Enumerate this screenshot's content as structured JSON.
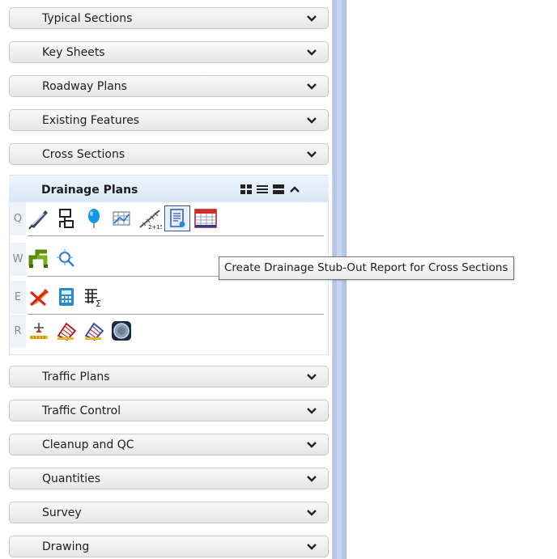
{
  "sections_top": [
    {
      "label": "Typical Sections"
    },
    {
      "label": "Key Sheets"
    },
    {
      "label": "Roadway Plans"
    },
    {
      "label": "Existing Features"
    },
    {
      "label": "Cross Sections"
    }
  ],
  "expanded": {
    "label": "Drainage Plans",
    "rows": [
      {
        "key": "Q",
        "tools": [
          "feather-pen-icon",
          "flowchart-icon",
          "blue-balloon-icon",
          "grid-chart-icon",
          "measure-line-icon",
          "report-document-icon",
          "spreadsheet-table-icon"
        ]
      },
      {
        "key": "W",
        "tools": [
          "pipe-network-icon",
          "search-sparkle-icon"
        ]
      },
      {
        "key": "E",
        "tools": [
          "pencil-eraser-icon",
          "calculator-icon",
          "table-sum-icon"
        ]
      },
      {
        "key": "R",
        "tools": [
          "survey-point-icon",
          "grid-edit-icon",
          "grid-edit-blue-icon",
          "manhole-icon"
        ]
      }
    ]
  },
  "sections_bottom": [
    {
      "label": "Traffic Plans"
    },
    {
      "label": "Traffic Control"
    },
    {
      "label": "Cleanup and QC"
    },
    {
      "label": "Quantities"
    },
    {
      "label": "Survey"
    },
    {
      "label": "Drawing"
    }
  ],
  "tooltip": "Create Drainage Stub-Out Report for Cross Sections"
}
